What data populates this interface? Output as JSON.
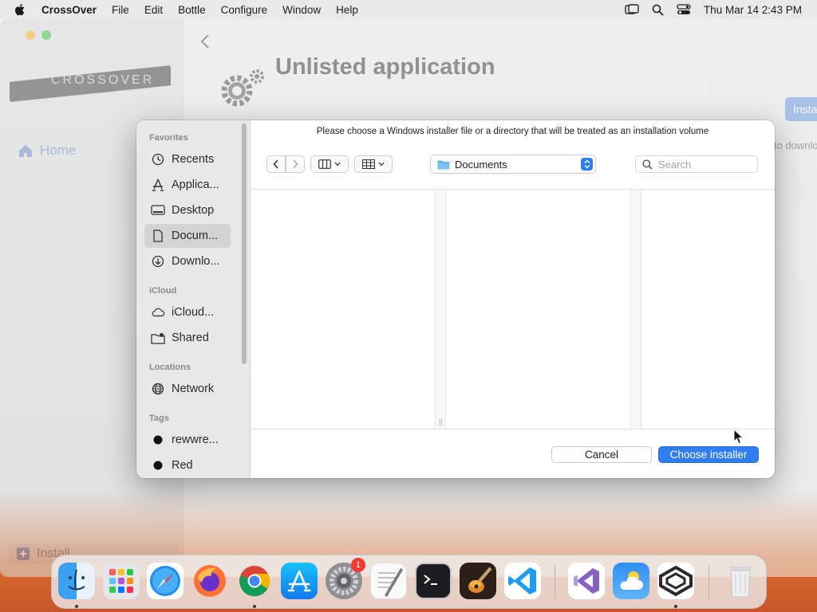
{
  "menubar": {
    "app_name": "CrossOver",
    "items": [
      "File",
      "Edit",
      "Bottle",
      "Configure",
      "Window",
      "Help"
    ],
    "clock": "Thu Mar 14  2:43 PM"
  },
  "app_window": {
    "logo_text": "CROSSOVER",
    "home_label": "Home",
    "install_label": "Install",
    "title": "Unlisted application",
    "install_button_label": "Insta",
    "download_text": "to downlo"
  },
  "dialog": {
    "prompt": "Please choose a Windows installer file or a directory that will be treated as an installation volume",
    "sidebar": {
      "favorites_header": "Favorites",
      "favorites": [
        {
          "label": "Recents",
          "icon": "clock-icon"
        },
        {
          "label": "Applica...",
          "icon": "applications-icon"
        },
        {
          "label": "Desktop",
          "icon": "desktop-icon"
        },
        {
          "label": "Docum...",
          "icon": "document-icon",
          "selected": true
        },
        {
          "label": "Downlo...",
          "icon": "download-icon"
        }
      ],
      "icloud_header": "iCloud",
      "icloud": [
        {
          "label": "iCloud...",
          "icon": "cloud-icon"
        },
        {
          "label": "Shared",
          "icon": "shared-folder-icon"
        }
      ],
      "locations_header": "Locations",
      "locations": [
        {
          "label": "Network",
          "icon": "globe-icon"
        }
      ],
      "tags_header": "Tags",
      "tags": [
        {
          "label": "rewwre...",
          "color": "#111111"
        },
        {
          "label": "Red",
          "color": "#111111"
        }
      ]
    },
    "location": "Documents",
    "search_placeholder": "Search",
    "cancel_label": "Cancel",
    "choose_label": "Choose installer",
    "accent_color": "#2f7ef1"
  },
  "dock": {
    "settings_badge": "1",
    "apps": [
      "Finder",
      "Launchpad",
      "Safari",
      "Firefox",
      "Chrome",
      "App Store",
      "System Settings",
      "TextEdit",
      "Terminal",
      "GarageBand",
      "VS Code",
      "Visual Studio",
      "Weather",
      "CrossOver",
      "Trash"
    ]
  }
}
